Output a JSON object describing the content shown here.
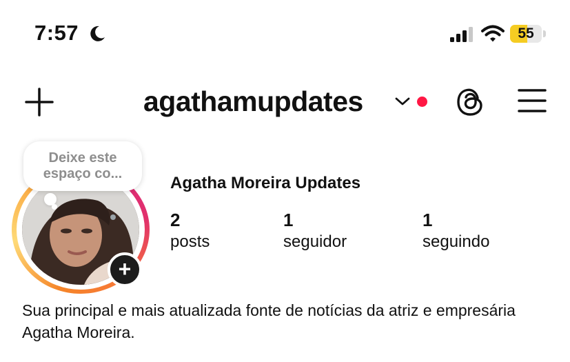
{
  "status_bar": {
    "time": "7:57",
    "battery_level": "55",
    "battery_fraction": 0.55,
    "icons": [
      "moon-icon",
      "cellular-signal-icon",
      "wifi-icon",
      "battery-icon"
    ]
  },
  "header": {
    "username": "agathamupdates",
    "has_notification_dot": true,
    "icons": [
      "plus-icon",
      "chevron-down-icon",
      "threads-icon",
      "hamburger-menu-icon"
    ]
  },
  "note": {
    "text": "Deixe este espaço co..."
  },
  "profile": {
    "display_name": "Agatha Moreira Updates",
    "stats": {
      "posts": {
        "value": "2",
        "label": "posts"
      },
      "followers": {
        "value": "1",
        "label": "seguidor"
      },
      "following": {
        "value": "1",
        "label": "seguindo"
      }
    },
    "bio": "Sua principal e mais atualizada fonte de notícias da atriz e empresária Agatha Moreira."
  },
  "colors": {
    "accent_red": "#ff1744",
    "battery_yellow": "#f5cc22",
    "text": "#111111",
    "muted": "#8e8e8e"
  }
}
